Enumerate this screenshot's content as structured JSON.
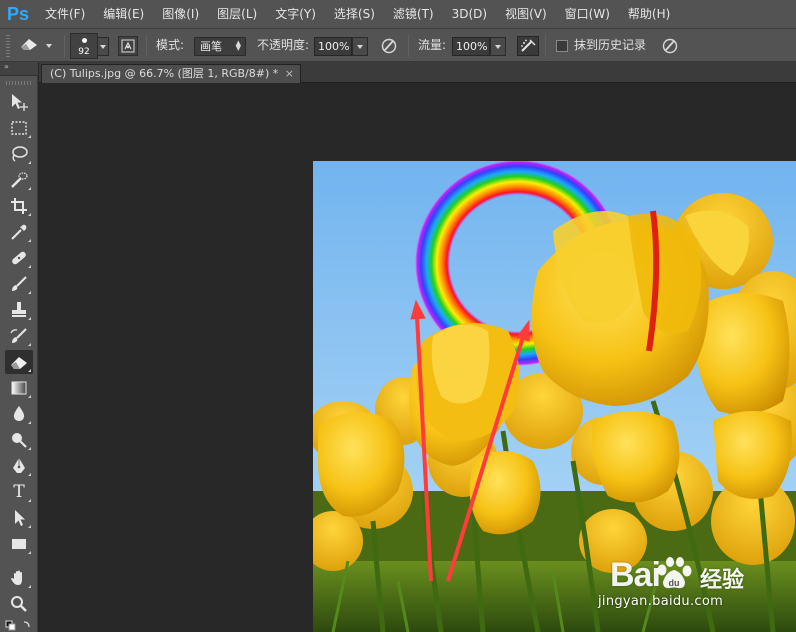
{
  "app": {
    "logo_text": "Ps"
  },
  "menu": [
    "文件(F)",
    "编辑(E)",
    "图像(I)",
    "图层(L)",
    "文字(Y)",
    "选择(S)",
    "滤镜(T)",
    "3D(D)",
    "视图(V)",
    "窗口(W)",
    "帮助(H)"
  ],
  "options": {
    "brush_size": "92",
    "mode_label": "模式:",
    "mode_value": "画笔",
    "opacity_label": "不透明度:",
    "opacity_value": "100%",
    "flow_label": "流量:",
    "flow_value": "100%",
    "erase_history_label": "抹到历史记录"
  },
  "tools_header": "»",
  "document": {
    "tab_title": "(C) Tulips.jpg @ 66.7% (图层 1, RGB/8#) *",
    "close_glyph": "×"
  },
  "tools": [
    {
      "name": "move-tool-icon"
    },
    {
      "name": "marquee-tool-icon"
    },
    {
      "name": "lasso-tool-icon"
    },
    {
      "name": "quick-selection-tool-icon"
    },
    {
      "name": "crop-tool-icon"
    },
    {
      "name": "eyedropper-tool-icon"
    },
    {
      "name": "healing-brush-tool-icon"
    },
    {
      "name": "brush-tool-icon"
    },
    {
      "name": "clone-stamp-tool-icon"
    },
    {
      "name": "history-brush-tool-icon"
    },
    {
      "name": "eraser-tool-icon",
      "active": true
    },
    {
      "name": "gradient-tool-icon"
    },
    {
      "name": "blur-tool-icon"
    },
    {
      "name": "dodge-tool-icon"
    },
    {
      "name": "pen-tool-icon"
    },
    {
      "name": "type-tool-icon",
      "label": "T"
    },
    {
      "name": "path-selection-tool-icon"
    },
    {
      "name": "rectangle-tool-icon"
    },
    {
      "name": "hand-tool-icon"
    },
    {
      "name": "zoom-tool-icon"
    }
  ],
  "watermark": {
    "brand": "Bai",
    "brand_cn": "经验",
    "url": "jingyan.baidu.com"
  },
  "colors": {
    "ps_blue": "#31a8ff",
    "panel_gray": "#535353",
    "workspace": "#282828",
    "arrow_red": "#ff3b3b"
  }
}
